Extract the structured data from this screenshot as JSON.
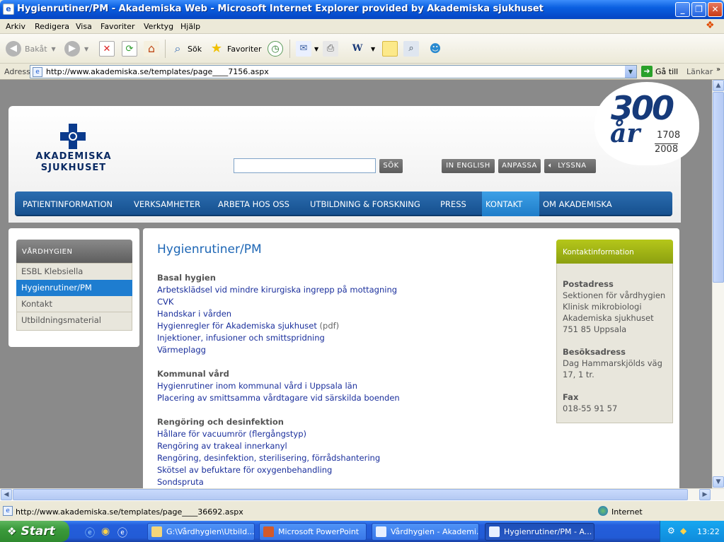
{
  "window": {
    "title": "Hygienrutiner/PM - Akademiska Web - Microsoft Internet Explorer provided by Akademiska sjukhuset"
  },
  "menu": [
    "Arkiv",
    "Redigera",
    "Visa",
    "Favoriter",
    "Verktyg",
    "Hjälp"
  ],
  "toolbar": {
    "back": "Bakåt",
    "search": "Sök",
    "favorites": "Favoriter"
  },
  "address": {
    "label": "Adress",
    "url": "http://www.akademiska.se/templates/page____7156.aspx",
    "go": "Gå till",
    "links": "Länkar"
  },
  "site": {
    "logo_line1": "AKADEMISKA",
    "logo_line2": "SJUKHUSET",
    "search_button": "SÖK",
    "search_value": "",
    "btn_english": "IN ENGLISH",
    "btn_anpassa": "ANPASSA",
    "btn_lyssna": "LYSSNA",
    "anniv_number": "300",
    "anniv_word": "år",
    "anniv_year1": "1708",
    "anniv_year2": "2008",
    "nav": [
      "PATIENTINFORMATION",
      "VERKSAMHETER",
      "ARBETA HOS OSS",
      "UTBILDNING & FORSKNING",
      "PRESS",
      "KONTAKT",
      "OM AKADEMISKA"
    ],
    "nav_active": "KONTAKT",
    "sidebar": {
      "heading": "VÅRDHYGIEN",
      "items": [
        "ESBL Klebsiella",
        "Hygienrutiner/PM",
        "Kontakt",
        "Utbildningsmaterial"
      ]
    },
    "page_title": "Hygienrutiner/PM",
    "sections": [
      {
        "heading": "Basal hygien",
        "links": [
          "Arbetsklädsel vid mindre kirurgiska ingrepp på mottagning",
          "CVK",
          "Handskar i vården",
          "Hygienregler för Akademiska sjukhuset",
          "Injektioner, infusioner och smittspridning",
          "Värmeplagg"
        ],
        "pdf_suffix": "(pdf)"
      },
      {
        "heading": "Kommunal vård",
        "links": [
          "Hygienrutiner inom kommunal vård i Uppsala län",
          "Placering av smittsamma vårdtagare vid särskilda boenden"
        ]
      },
      {
        "heading": "Rengöring och desinfektion",
        "links": [
          "Hållare för vacuumrör (flergångstyp)",
          "Rengöring av trakeal innerkanyl",
          "Rengöring, desinfektion, sterilisering, förrådshantering",
          "Skötsel av befuktare för oxygenbehandling",
          "Sondspruta"
        ]
      }
    ],
    "contact": {
      "heading": "Kontaktinformation",
      "postal_label": "Postadress",
      "postal_lines": [
        "Sektionen för vårdhygien",
        "Klinisk mikrobiologi",
        "Akademiska sjukhuset",
        "751 85 Uppsala"
      ],
      "visit_label": "Besöksadress",
      "visit_lines": [
        "Dag Hammarskjölds väg",
        "17, 1 tr."
      ],
      "fax_label": "Fax",
      "fax": "018-55 91 57"
    }
  },
  "status": {
    "url": "http://www.akademiska.se/templates/page____36692.aspx",
    "zone": "Internet"
  },
  "taskbar": {
    "start": "Start",
    "tasks": [
      "G:\\Vårdhygien\\Utbild...",
      "Microsoft PowerPoint",
      "Vårdhygien - Akademi...",
      "Hygienrutiner/PM - A..."
    ],
    "clock": "13:22"
  },
  "colors": {
    "nav": "#1d5d9e",
    "nav_active": "#2c8ed8",
    "link": "#1a2f9c",
    "title": "#1d66b5",
    "contact_head": "#a2b416"
  }
}
